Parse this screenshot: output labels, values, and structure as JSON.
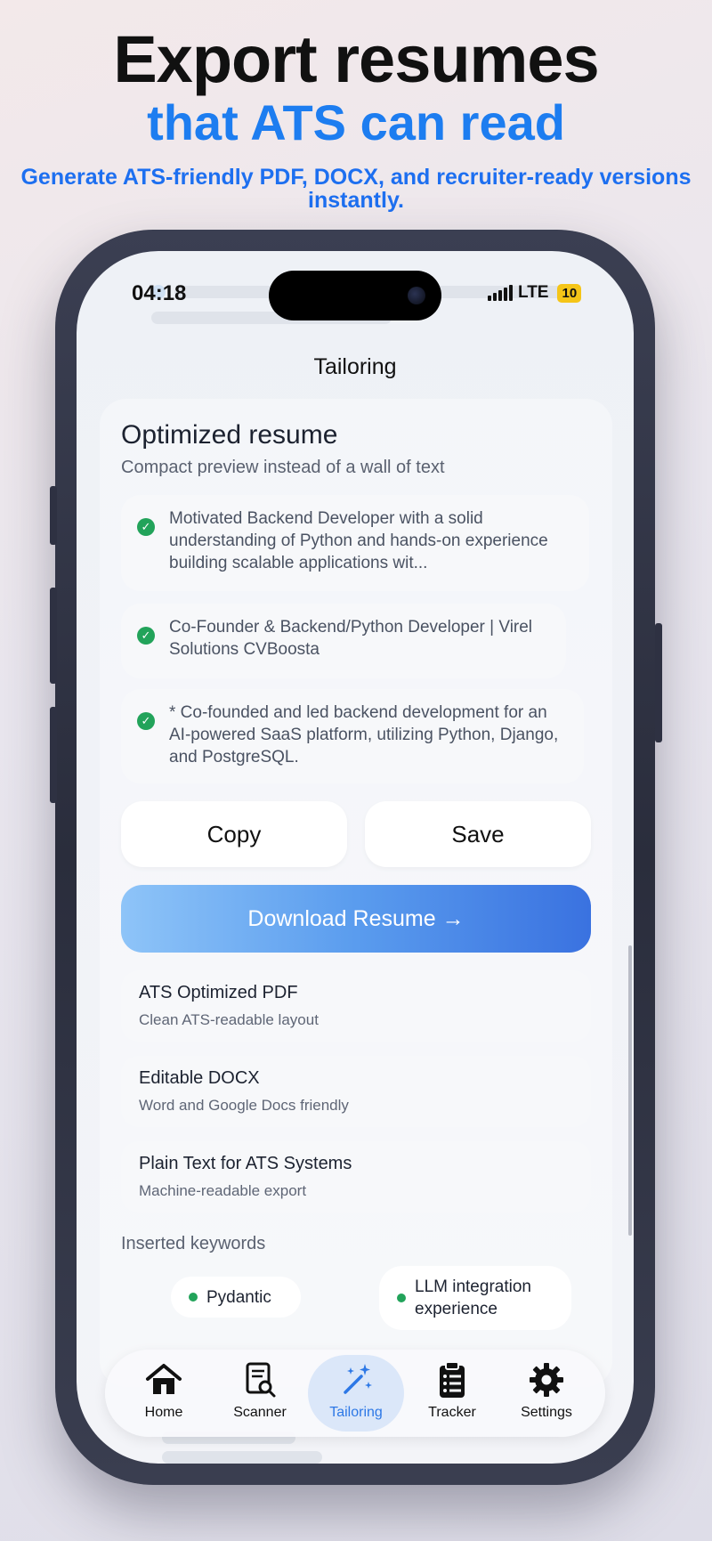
{
  "hero": {
    "title": "Export resumes",
    "subtitle": "that ATS can read",
    "description": "Generate ATS-friendly PDF, DOCX, and recruiter-ready versions instantly."
  },
  "status_bar": {
    "time": "04:18",
    "network": "LTE",
    "battery": "10"
  },
  "nav": {
    "title": "Tailoring"
  },
  "resume_card": {
    "title": "Optimized resume",
    "subtitle": "Compact preview instead of a wall of text",
    "bullets": [
      "Motivated Backend Developer with a solid understanding of Python and hands-on experience building scalable applications wit...",
      "Co-Founder & Backend/Python Developer | Virel Solutions CVBoosta",
      "*   Co-founded and led backend development for an AI-powered SaaS platform, utilizing Python, Django, and PostgreSQL."
    ],
    "copy_label": "Copy",
    "save_label": "Save",
    "download_label": "Download Resume →",
    "formats": [
      {
        "title": "ATS Optimized PDF",
        "subtitle": "Clean ATS-readable layout"
      },
      {
        "title": "Editable DOCX",
        "subtitle": "Word and Google Docs friendly"
      },
      {
        "title": "Plain Text for ATS Systems",
        "subtitle": "Machine-readable export"
      }
    ],
    "keywords_label": "Inserted keywords",
    "keywords": [
      "Pydantic",
      "LLM integration experience"
    ]
  },
  "tabbar": {
    "items": [
      {
        "label": "Home",
        "icon": "home-icon"
      },
      {
        "label": "Scanner",
        "icon": "document-scan-icon"
      },
      {
        "label": "Tailoring",
        "icon": "magic-wand-icon",
        "active": true
      },
      {
        "label": "Tracker",
        "icon": "clipboard-icon"
      },
      {
        "label": "Settings",
        "icon": "gear-icon"
      }
    ]
  },
  "colors": {
    "accent": "#2d78e6",
    "hero_blue": "#1d7df0",
    "check_green": "#22a35a"
  }
}
